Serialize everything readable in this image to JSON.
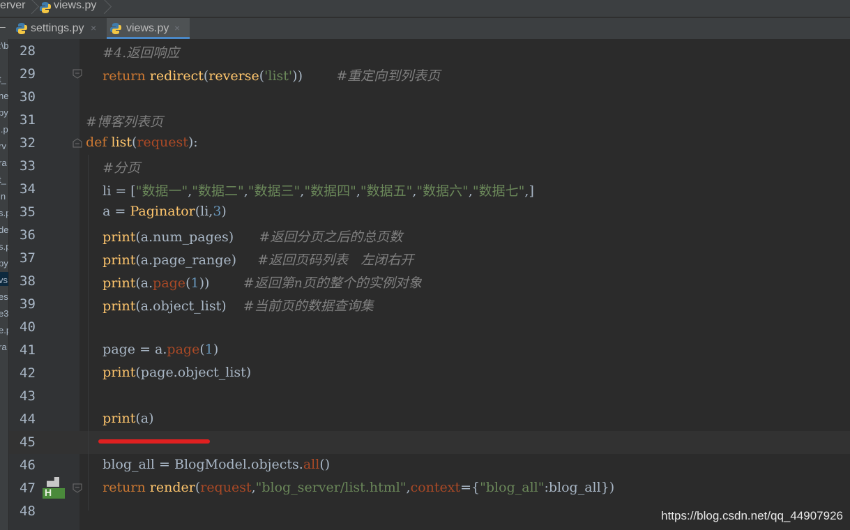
{
  "breadcrumb": {
    "items": [
      "erver",
      "views.py"
    ]
  },
  "tabs": [
    {
      "label": "settings.py",
      "close": "×",
      "active": false
    },
    {
      "label": "views.py",
      "close": "×",
      "active": true
    }
  ],
  "sidebar": {
    "fragments": [
      ":\\b",
      "t_",
      "ne",
      "py",
      "l.p",
      "rv",
      "ra",
      "t_",
      "in",
      "s.p",
      "de",
      "s.p",
      "py",
      "vs.",
      "es",
      "e3",
      "e.p",
      "ra"
    ]
  },
  "code": {
    "lines": [
      {
        "n": "28",
        "text": "    #4.返回响应"
      },
      {
        "n": "29",
        "text": "    return redirect(reverse('list'))        #重定向到列表页"
      },
      {
        "n": "30",
        "text": ""
      },
      {
        "n": "31",
        "text": "#博客列表页"
      },
      {
        "n": "32",
        "text": "def list(request):"
      },
      {
        "n": "33",
        "text": "    #分页"
      },
      {
        "n": "34",
        "text": "    li = [\"数据一\",\"数据二\",\"数据三\",\"数据四\",\"数据五\",\"数据六\",\"数据七\",]"
      },
      {
        "n": "35",
        "text": "    a = Paginator(li,3)"
      },
      {
        "n": "36",
        "text": "    print(a.num_pages)      #返回分页之后的总页数"
      },
      {
        "n": "37",
        "text": "    print(a.page_range)     #返回页码列表   左闭右开"
      },
      {
        "n": "38",
        "text": "    print(a.page(1))        #返回第n页的整个的实例对象"
      },
      {
        "n": "39",
        "text": "    print(a.object_list)    #当前页的数据查询集"
      },
      {
        "n": "40",
        "text": ""
      },
      {
        "n": "41",
        "text": "    page = a.page(1)"
      },
      {
        "n": "42",
        "text": "    print(page.object_list)"
      },
      {
        "n": "43",
        "text": ""
      },
      {
        "n": "44",
        "text": "    print(a)"
      },
      {
        "n": "45",
        "text": ""
      },
      {
        "n": "46",
        "text": "    blog_all = BlogModel.objects.all()"
      },
      {
        "n": "47",
        "text": "    return render(request,\"blog_server/list.html\",context={\"blog_all\":blog_all})"
      },
      {
        "n": "48",
        "text": ""
      }
    ]
  },
  "gutter_badge": "H",
  "watermark": "https://blog.csdn.net/qq_44907926",
  "colors": {
    "background": "#2b2b2b",
    "keyword": "#cc7832",
    "function": "#ffc66d",
    "string": "#6a8759",
    "number": "#6897bb",
    "comment": "#808080",
    "parameter": "#aa4926",
    "annotation_line": "#e02020",
    "tab_underline": "#4a88c7"
  },
  "icons": [
    "python-file-icon",
    "close-icon",
    "fold-marker-icon",
    "history-icon"
  ]
}
